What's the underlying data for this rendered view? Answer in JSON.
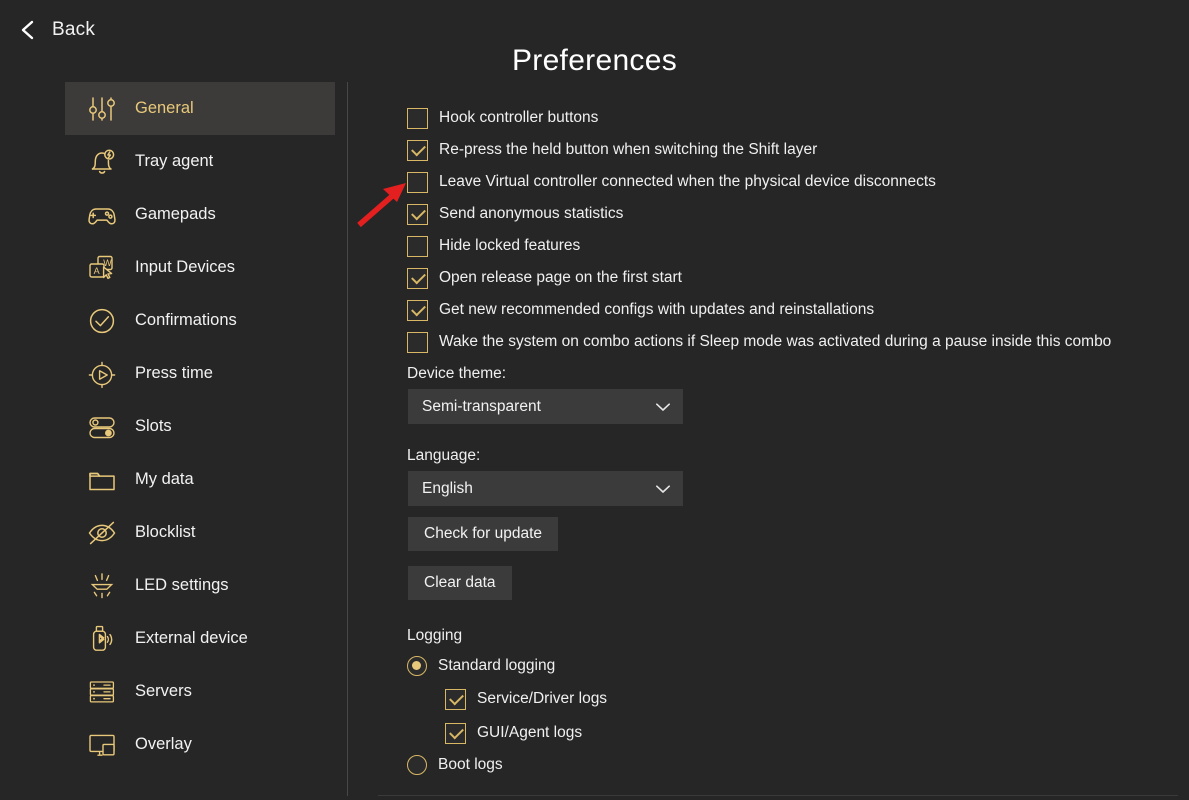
{
  "window": {
    "background_color": "#262626",
    "accent_color": "#e8c87a",
    "text_color": "#f2f2f2"
  },
  "header": {
    "back_label": "Back",
    "back_icon": "chevron-left-icon",
    "title": "Preferences"
  },
  "sidebar": {
    "items": [
      {
        "label": "General",
        "icon": "sliders-icon",
        "active": true
      },
      {
        "label": "Tray agent",
        "icon": "bell-bolt-icon",
        "active": false
      },
      {
        "label": "Gamepads",
        "icon": "gamepad-icon",
        "active": false
      },
      {
        "label": "Input Devices",
        "icon": "keyboard-mouse-icon",
        "active": false
      },
      {
        "label": "Confirmations",
        "icon": "check-circle-icon",
        "active": false
      },
      {
        "label": "Press time",
        "icon": "stopwatch-play-icon",
        "active": false
      },
      {
        "label": "Slots",
        "icon": "toggles-icon",
        "active": false
      },
      {
        "label": "My data",
        "icon": "folder-icon",
        "active": false
      },
      {
        "label": "Blocklist",
        "icon": "eye-slash-icon",
        "active": false
      },
      {
        "label": "LED settings",
        "icon": "led-light-icon",
        "active": false
      },
      {
        "label": "External device",
        "icon": "usb-bluetooth-icon",
        "active": false
      },
      {
        "label": "Servers",
        "icon": "servers-icon",
        "active": false
      },
      {
        "label": "Overlay",
        "icon": "overlay-monitor-icon",
        "active": false
      }
    ]
  },
  "main": {
    "checkboxes": [
      {
        "label": "Hook controller buttons",
        "checked": false
      },
      {
        "label": "Re-press the held button when switching the Shift layer",
        "checked": true
      },
      {
        "label": "Leave Virtual controller connected when the physical device disconnects",
        "checked": false
      },
      {
        "label": "Send anonymous statistics",
        "checked": true
      },
      {
        "label": "Hide locked features",
        "checked": false
      },
      {
        "label": "Open release page on the first start",
        "checked": true
      },
      {
        "label": "Get new recommended configs with updates and reinstallations",
        "checked": true
      },
      {
        "label": "Wake the system on combo actions if Sleep mode was activated during a pause inside this combo",
        "checked": false
      }
    ],
    "device_theme": {
      "label": "Device theme:",
      "value": "Semi-transparent",
      "caret_icon": "chevron-down-icon"
    },
    "language": {
      "label": "Language:",
      "value": "English",
      "caret_icon": "chevron-down-icon"
    },
    "buttons": {
      "check_for_update": "Check for update",
      "clear_data": "Clear data"
    },
    "logging": {
      "heading": "Logging",
      "options": [
        {
          "label": "Standard logging",
          "selected": true
        },
        {
          "label": "Boot logs",
          "selected": false
        }
      ],
      "sub_checkboxes": [
        {
          "label": "Service/Driver logs",
          "checked": true
        },
        {
          "label": "GUI/Agent logs",
          "checked": true
        }
      ]
    }
  },
  "annotation": {
    "arrow_color": "#e41f1f",
    "arrow_points_to": "Leave Virtual controller connected when the physical device disconnects"
  }
}
